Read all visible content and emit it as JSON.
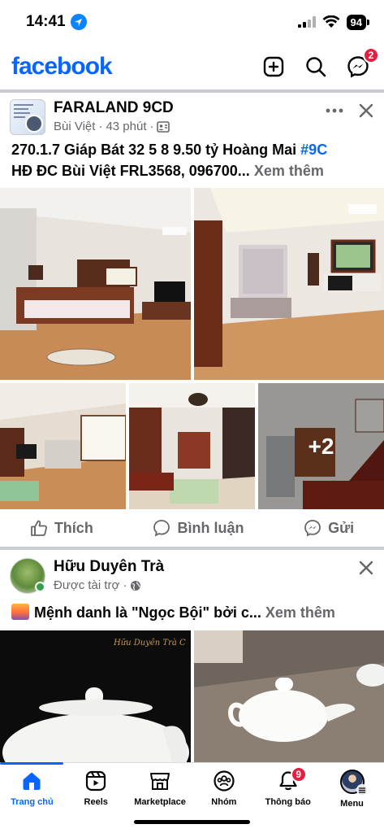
{
  "status_bar": {
    "time": "14:41",
    "battery": "94"
  },
  "header": {
    "logo": "facebook",
    "messenger_badge": "2"
  },
  "post1": {
    "page_name": "FARALAND 9CD",
    "author": "Bùi Việt",
    "time": "43 phút",
    "text_line1": "270.1.7 Giáp Bát 32 5 8 9.50 tỷ Hoàng Mai ",
    "hashtag": "#9C",
    "text_line2": "HĐ ĐC Bùi Việt FRL3568, 096700...",
    "see_more": "Xem thêm",
    "more_photos": "+2",
    "actions": {
      "like": "Thích",
      "comment": "Bình luận",
      "send": "Gửi"
    }
  },
  "post2": {
    "page_name": "Hữu Duyên Trà",
    "sponsored": "Được tài trợ",
    "text": "Mệnh danh là \"Ngọc Bội\" bởi c...",
    "see_more": "Xem thêm",
    "image_caption": "Hữu Duyên Trà C"
  },
  "bottom_nav": {
    "items": [
      {
        "label": "Trang chủ"
      },
      {
        "label": "Reels"
      },
      {
        "label": "Marketplace"
      },
      {
        "label": "Nhóm"
      },
      {
        "label": "Thông báo",
        "badge": "9"
      },
      {
        "label": "Menu"
      }
    ]
  },
  "colors": {
    "brand": "#0866ff",
    "badge": "#e41e3f",
    "secondary_text": "#65676b"
  }
}
